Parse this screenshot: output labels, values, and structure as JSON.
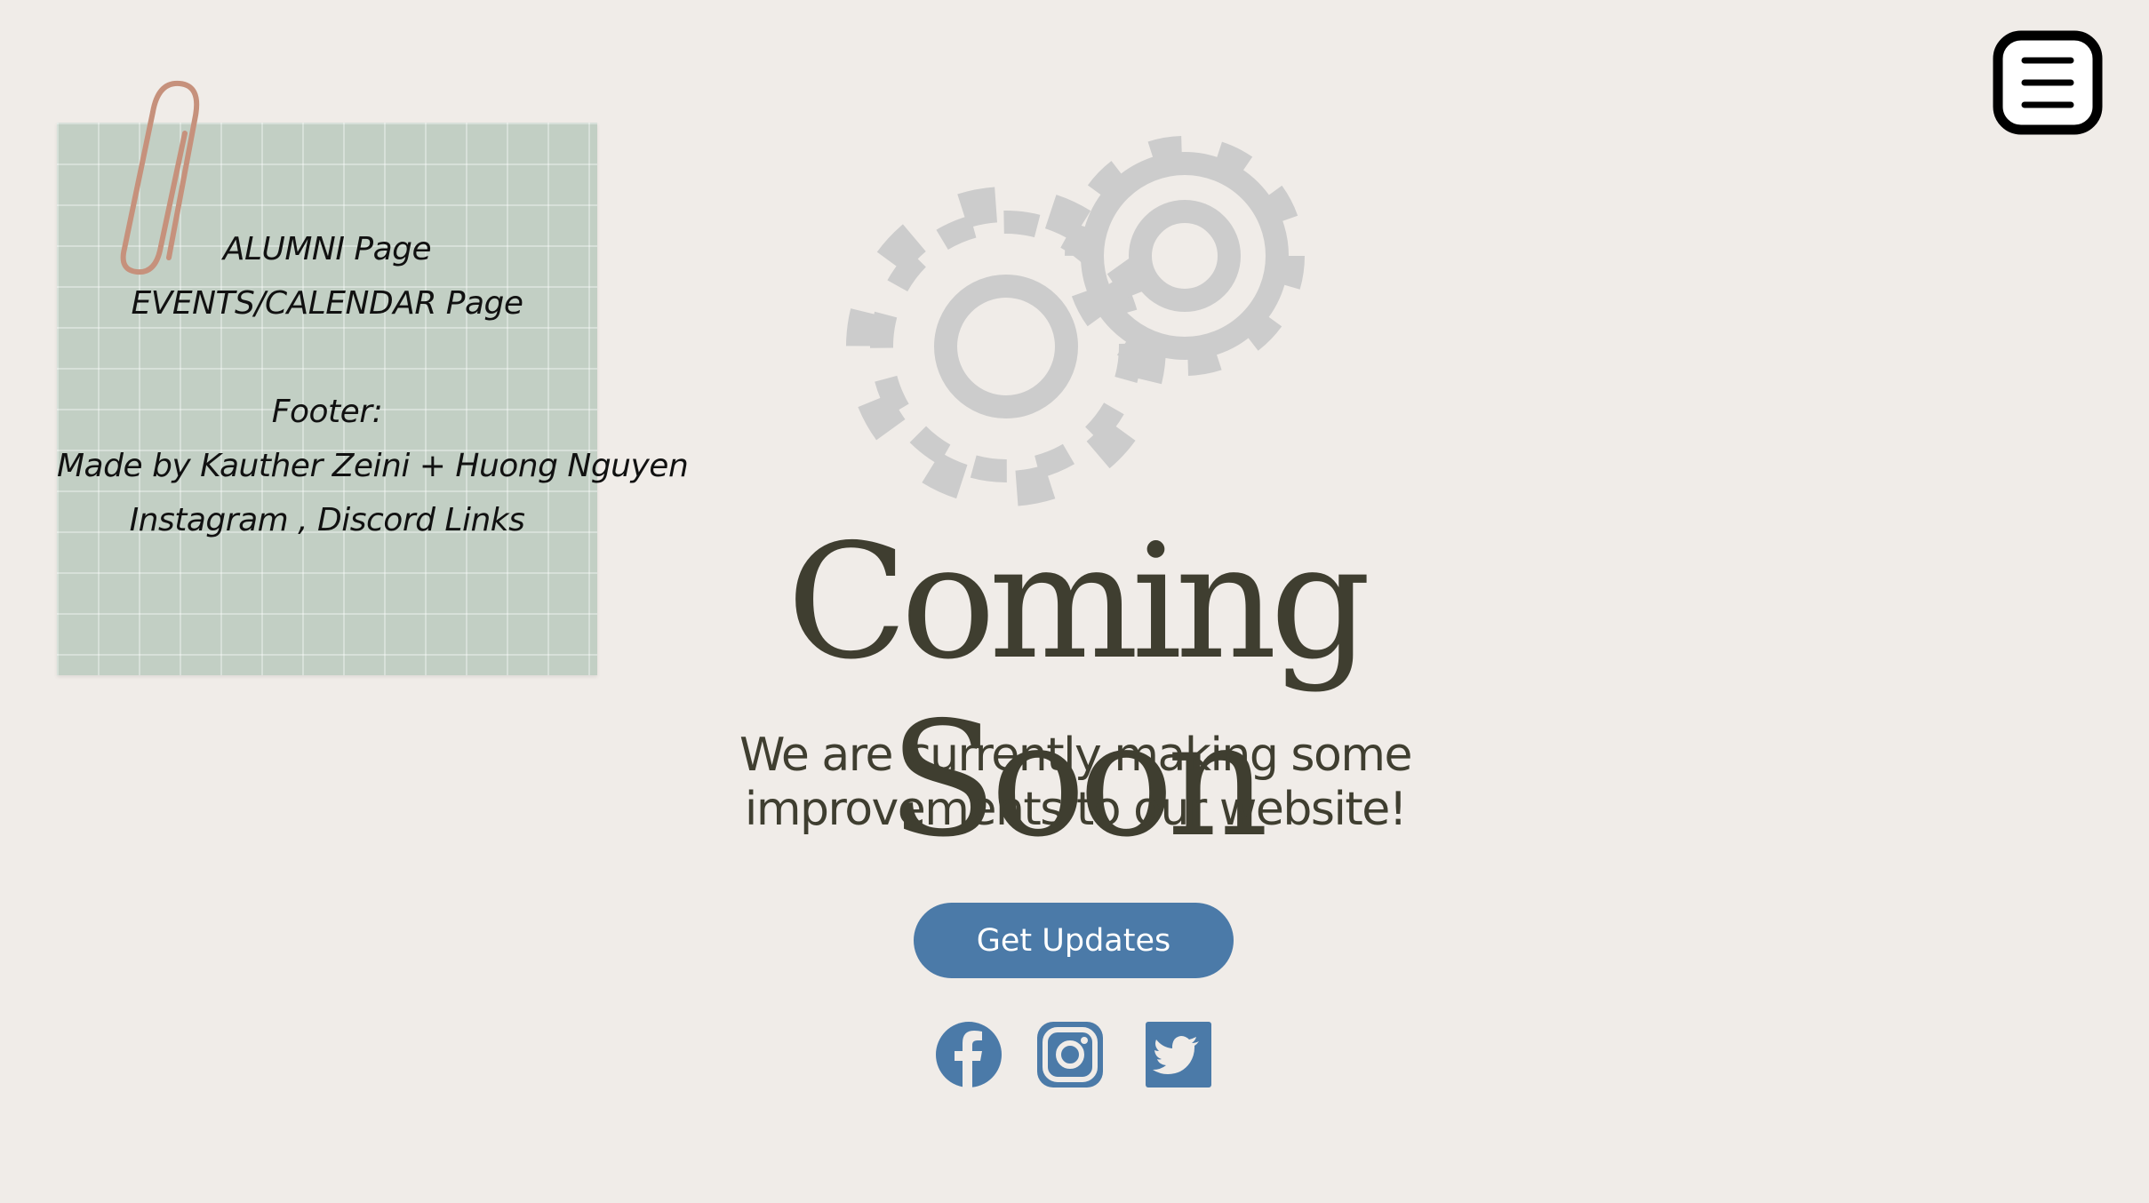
{
  "note": {
    "lines": [
      "ALUMNI Page",
      "EVENTS/CALENDAR Page",
      "",
      "Footer:",
      "Made by Kauther Zeini + Huong Nguyen",
      "Instagram , Discord Links"
    ]
  },
  "hero": {
    "title": "Coming Soon",
    "subtitle_line1": "We are currently making some",
    "subtitle_line2": "improvements to our website!",
    "button_label": "Get Updates"
  },
  "icons": {
    "menu": "menu-icon",
    "gears": "gears-icon",
    "facebook": "facebook-icon",
    "instagram": "instagram-icon",
    "twitter": "twitter-icon",
    "paperclip": "paperclip-icon"
  },
  "colors": {
    "background": "#f0ece8",
    "note": "#c2cfc4",
    "text": "#3f3e30",
    "accent": "#4b7aa8",
    "gear": "#cccccc"
  }
}
